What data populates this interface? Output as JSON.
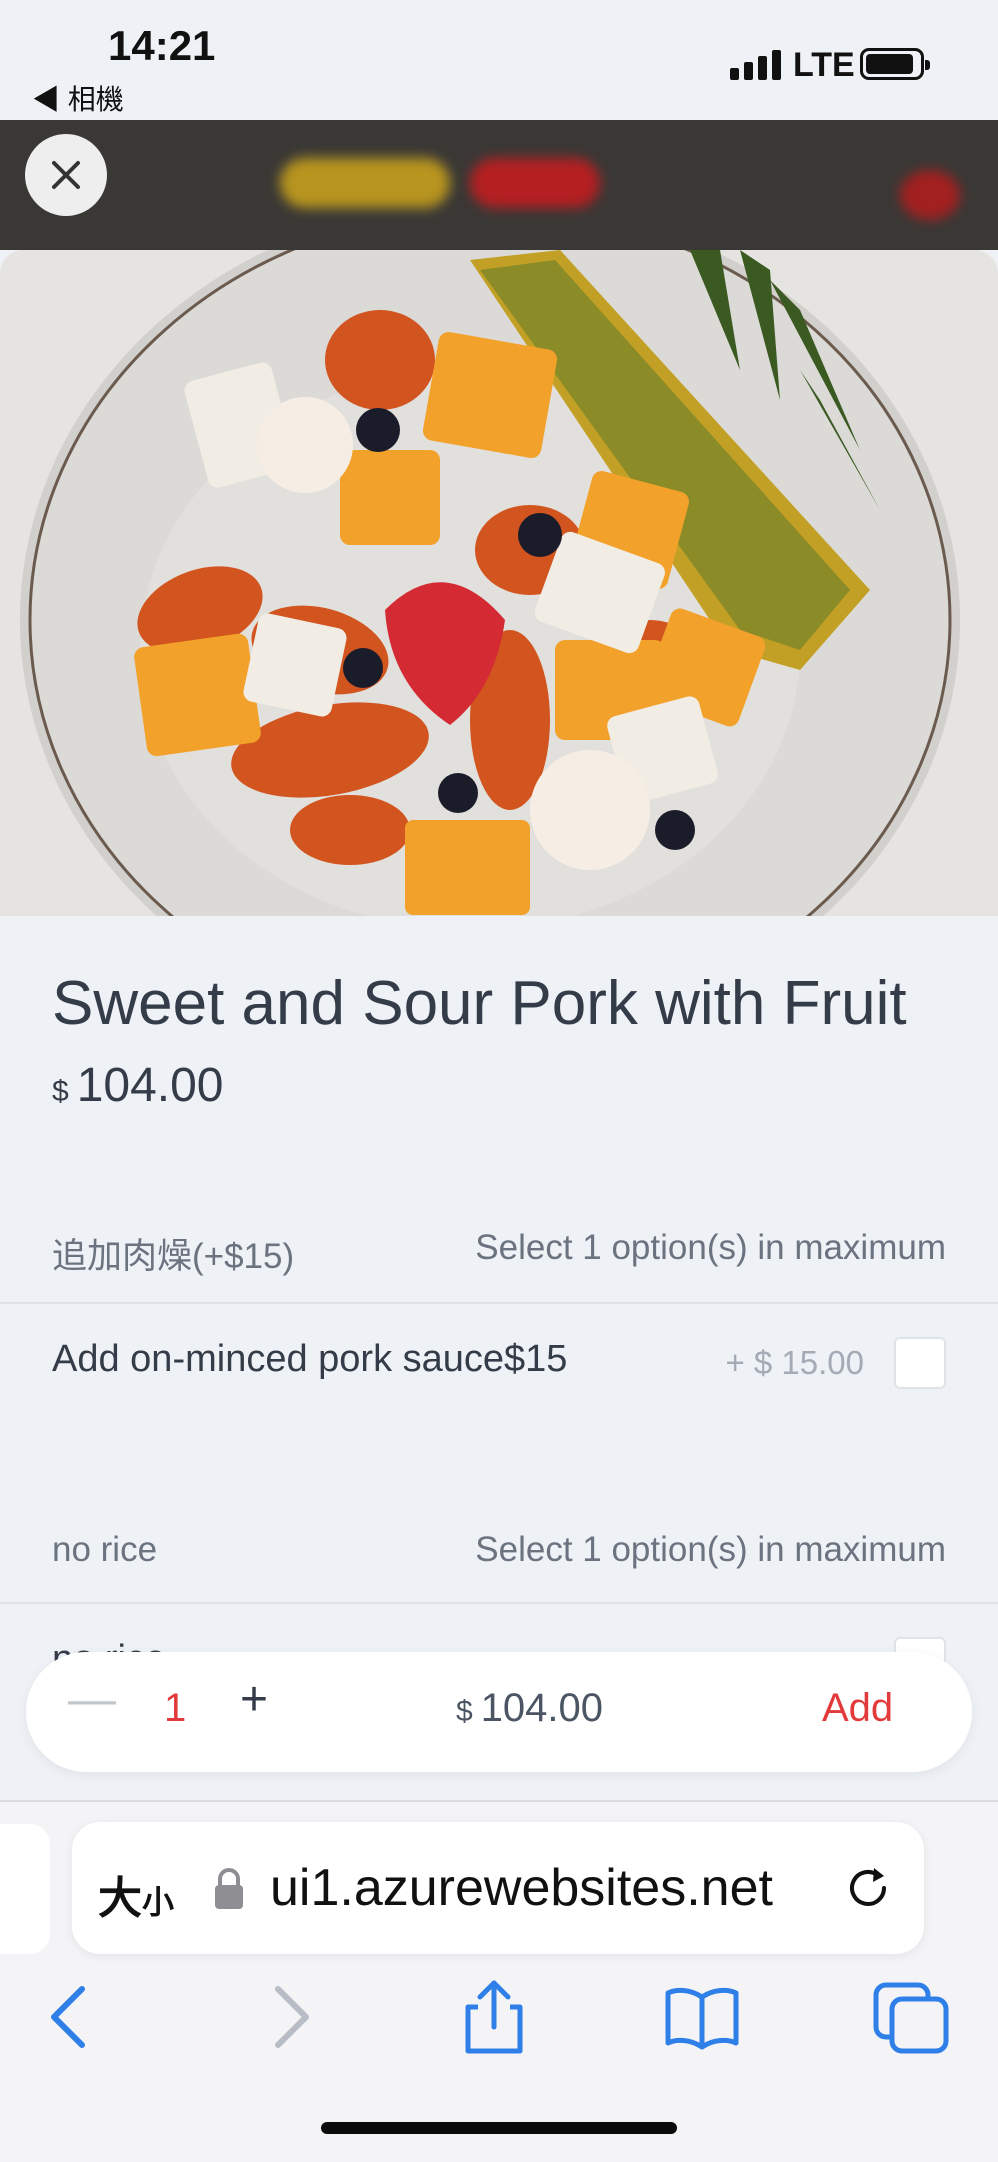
{
  "status_bar": {
    "time": "14:21",
    "back_app": "◀ 相機",
    "network": "LTE"
  },
  "item": {
    "name": "Sweet and Sour Pork with Fruit",
    "currency": "$",
    "price": "104.00"
  },
  "groups": [
    {
      "name": "追加肉燥(+$15)",
      "rule": "Select 1 option(s) in maximum",
      "options": [
        {
          "label": "Add on-minced pork sauce$15",
          "price": "+ $ 15.00",
          "checked": false
        }
      ]
    },
    {
      "name": "no rice",
      "rule": "Select 1 option(s) in maximum",
      "options": [
        {
          "label": "no rice",
          "checked": false
        }
      ]
    }
  ],
  "cart": {
    "quantity": "1",
    "currency": "$",
    "total": "104.00",
    "add_label": "Add"
  },
  "browser": {
    "text_size_label": "大",
    "text_size_small": "小",
    "url": "ui1.azurewebsites.net"
  },
  "colors": {
    "accent": "#e23a3a",
    "ios_blue": "#2f7fe8",
    "text": "#333c48",
    "muted": "#6b7280"
  }
}
